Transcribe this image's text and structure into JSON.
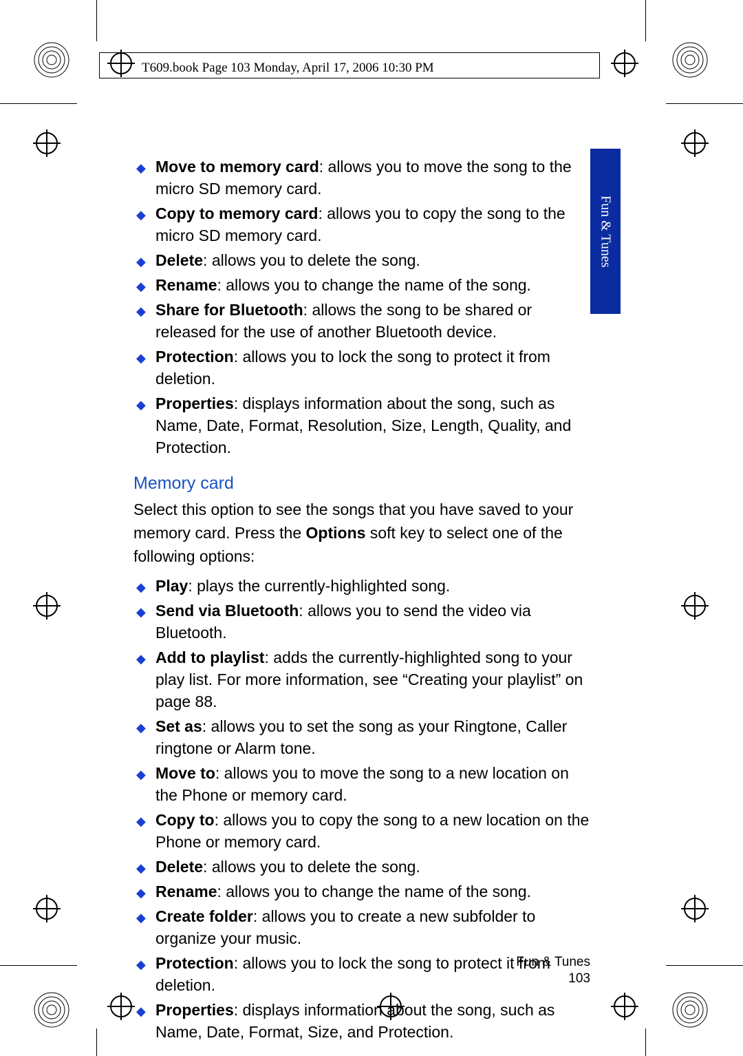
{
  "header": "T609.book  Page 103  Monday, April 17, 2006  10:30 PM",
  "side_tab": "Fun & Tunes",
  "list_a": [
    {
      "term": "Move to memory card",
      "desc": ": allows you to move the song to the micro SD memory card."
    },
    {
      "term": "Copy to memory card",
      "desc": ": allows you to copy the song to the micro SD memory card."
    },
    {
      "term": "Delete",
      "desc": ": allows you to delete the song."
    },
    {
      "term": "Rename",
      "desc": ": allows you to change the name of the song."
    },
    {
      "term": "Share for Bluetooth",
      "desc": ": allows the song to be shared or released for the use of another Bluetooth device."
    },
    {
      "term": "Protection",
      "desc": ": allows you to lock the song to protect it from deletion."
    },
    {
      "term": "Properties",
      "desc": ": displays information about the song, such as Name, Date, Format, Resolution, Size, Length, Quality, and Protection."
    }
  ],
  "section_heading": "Memory card",
  "intro_pre": "Select this option to see the songs that you have saved to your memory card. Press the ",
  "intro_bold": "Options",
  "intro_post": " soft key to select one of the following options:",
  "list_b": [
    {
      "term": "Play",
      "desc": ": plays the currently-highlighted song."
    },
    {
      "term": "Send via Bluetooth",
      "desc": ": allows you to send the video via Bluetooth."
    },
    {
      "term": "Add to playlist",
      "desc": ": adds the currently-highlighted song to your play list. For more information, see “Creating your playlist” on page 88."
    },
    {
      "term": "Set as",
      "desc": ": allows you to set the song as your Ringtone, Caller ringtone or Alarm tone."
    },
    {
      "term": "Move to",
      "desc": ": allows you to move the song to a new location on the Phone or memory card."
    },
    {
      "term": "Copy to",
      "desc": ": allows you to copy the song to a new location on the Phone or memory card."
    },
    {
      "term": "Delete",
      "desc": ": allows you to delete the song."
    },
    {
      "term": "Rename",
      "desc": ": allows you to change the name of the song."
    },
    {
      "term": "Create folder",
      "desc": ": allows you to create a new subfolder to organize your music."
    },
    {
      "term": "Protection",
      "desc": ": allows you to lock the song to protect it from deletion."
    },
    {
      "term": "Properties",
      "desc": ": displays information about the song, such as Name, Date, Format, Size, and Protection."
    }
  ],
  "footer_section": "Fun & Tunes",
  "footer_page": "103"
}
